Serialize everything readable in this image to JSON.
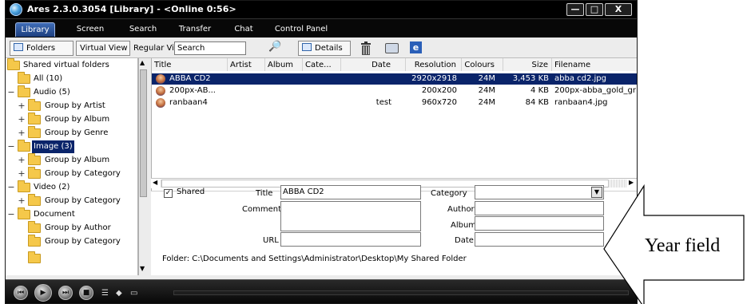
{
  "window": {
    "title": "Ares 2.3.0.3054  [Library]  -  <Online 0:56>",
    "min_glyph": "—",
    "max_glyph": "□",
    "close_glyph": "X"
  },
  "tabs": [
    {
      "label": "Library",
      "active": true
    },
    {
      "label": "Screen"
    },
    {
      "label": "Search"
    },
    {
      "label": "Transfer"
    },
    {
      "label": "Chat"
    },
    {
      "label": "Control Panel"
    }
  ],
  "toolbar": {
    "folders_label": "Folders",
    "virtual_view_label": "Virtual View",
    "regular_view_label": "Regular View",
    "search_value": "Search",
    "search_icon": "🔎",
    "details_label": "Details",
    "web_glyph": "e"
  },
  "tree": {
    "items": [
      {
        "label": "Shared virtual folders",
        "expander": ""
      },
      {
        "label": "All (10)",
        "expander": ""
      },
      {
        "label": "Audio (5)",
        "expander": "−"
      },
      {
        "label": "Group by Artist",
        "expander": "+"
      },
      {
        "label": "Group by Album",
        "expander": "+"
      },
      {
        "label": "Group by Genre",
        "expander": "+"
      },
      {
        "label": "Image (3)",
        "expander": "−"
      },
      {
        "label": "Group by Album",
        "expander": "+"
      },
      {
        "label": "Group by Category",
        "expander": "+"
      },
      {
        "label": "Video (2)",
        "expander": "−"
      },
      {
        "label": "Group by Category",
        "expander": "+"
      },
      {
        "label": "Document",
        "expander": "−"
      },
      {
        "label": "Group by Author",
        "expander": ""
      },
      {
        "label": "Group by Category",
        "expander": ""
      }
    ]
  },
  "table": {
    "columns": [
      "Title",
      "Artist",
      "Album",
      "Cate...",
      "Date",
      "Resolution",
      "Colours",
      "Size",
      "Filename"
    ],
    "rows": [
      {
        "title": "ABBA CD2",
        "artist": "",
        "album": "",
        "category": "",
        "date": "",
        "resolution": "2920x2918",
        "colours": "24M",
        "size": "3,453 KB",
        "filename": "abba cd2.jpg"
      },
      {
        "title": "200px-AB...",
        "artist": "",
        "album": "",
        "category": "",
        "date": "",
        "resolution": "200x200",
        "colours": "24M",
        "size": "4 KB",
        "filename": "200px-abba_gold_gr"
      },
      {
        "title": "ranbaan4",
        "artist": "",
        "album": "",
        "category": "",
        "date": "test",
        "resolution": "960x720",
        "colours": "24M",
        "size": "84 KB",
        "filename": "ranbaan4.jpg"
      }
    ]
  },
  "details": {
    "shared_label": "Shared",
    "shared_checked": "✓",
    "title_label": "Title",
    "title_value": "ABBA CD2",
    "comments_label": "Comments",
    "url_label": "URL",
    "category_label": "Category",
    "author_label": "Author",
    "album_label": "Album",
    "date_label": "Date",
    "folder_path": "Folder: C:\\Documents and Settings\\Administrator\\Desktop\\My Shared Folder"
  },
  "annotation": {
    "label": "Year field"
  }
}
